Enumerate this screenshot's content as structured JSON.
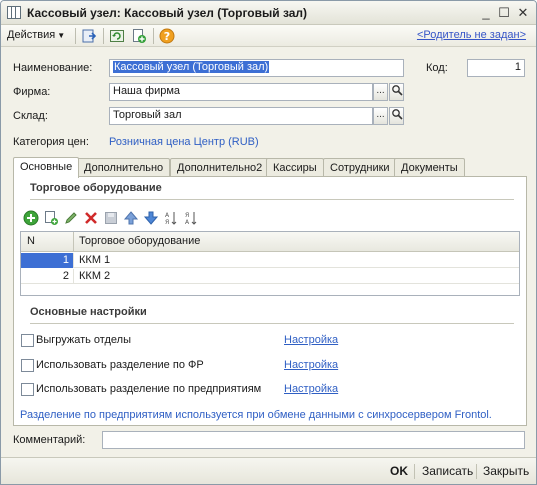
{
  "window": {
    "title": "Кассовый узел: Кассовый узел (Торговый зал)"
  },
  "toolbar": {
    "actions_label": "Действия",
    "parent_link": "<Родитель не задан>"
  },
  "form": {
    "name_label": "Наименование:",
    "name_value": "Кассовый узел (Торговый зал)",
    "code_label": "Код:",
    "code_value": "1",
    "firm_label": "Фирма:",
    "firm_value": "Наша фирма",
    "warehouse_label": "Склад:",
    "warehouse_value": "Торговый зал",
    "price_category_label": "Категория цен:",
    "price_category_value": "Розничная цена Центр (RUB)",
    "comment_label": "Комментарий:",
    "comment_value": "",
    "ellipsis": "...",
    "colon": ""
  },
  "tabs": [
    {
      "label": "Основные"
    },
    {
      "label": "Дополнительно"
    },
    {
      "label": "Дополнительно2"
    },
    {
      "label": "Кассиры"
    },
    {
      "label": "Сотрудники"
    },
    {
      "label": "Документы"
    }
  ],
  "equipment": {
    "section_title": "Торговое оборудование",
    "columns": [
      "N",
      "Торговое оборудование"
    ],
    "rows": [
      {
        "n": "1",
        "name": "ККМ 1"
      },
      {
        "n": "2",
        "name": "ККМ 2"
      }
    ]
  },
  "settings": {
    "section_title": "Основные настройки",
    "options": [
      {
        "label": "Выгружать отделы",
        "checked": false,
        "link": "Настройка"
      },
      {
        "label": "Использовать разделение по ФР",
        "checked": false,
        "link": "Настройка"
      },
      {
        "label": "Использовать разделение по предприятиям",
        "checked": false,
        "link": "Настройка"
      }
    ],
    "note": "Разделение по предприятиям используется при обмене данными с синхросервером Frontol."
  },
  "footer": {
    "ok": "OK",
    "save": "Записать",
    "close": "Закрыть"
  },
  "colors": {
    "link": "#2f5fc4",
    "selection": "#3d6fd4"
  }
}
